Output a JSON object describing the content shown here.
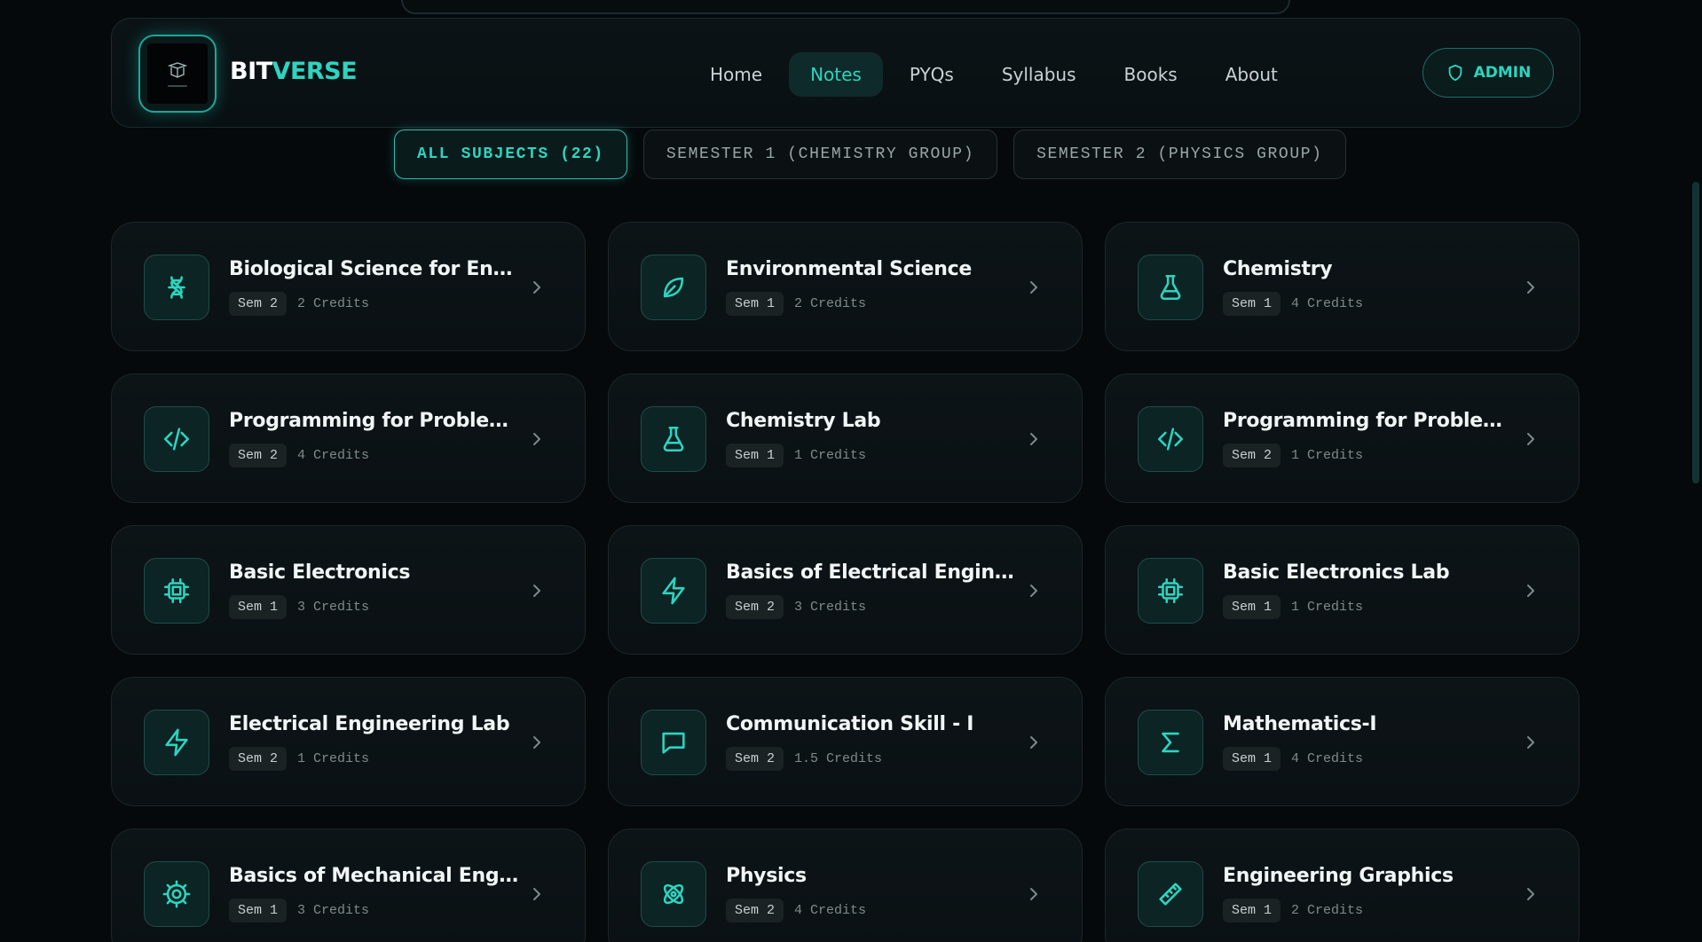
{
  "brand": {
    "part1": "BIT",
    "part2": "VERSE",
    "logo_icon": "book-logo-icon"
  },
  "nav": {
    "links": [
      {
        "label": "Home",
        "active": false
      },
      {
        "label": "Notes",
        "active": true
      },
      {
        "label": "PYQs",
        "active": false
      },
      {
        "label": "Syllabus",
        "active": false
      },
      {
        "label": "Books",
        "active": false
      },
      {
        "label": "About",
        "active": false
      }
    ],
    "admin_label": "ADMIN",
    "admin_icon": "shield-icon"
  },
  "filters": [
    {
      "label": "ALL SUBJECTS (22)",
      "active": true
    },
    {
      "label": "SEMESTER 1 (CHEMISTRY GROUP)",
      "active": false
    },
    {
      "label": "SEMESTER 2 (PHYSICS GROUP)",
      "active": false
    }
  ],
  "subjects": [
    {
      "title": "Biological Science for Engi...",
      "sem": "Sem 2",
      "credits": "2 Credits",
      "icon": "dna-icon"
    },
    {
      "title": "Environmental Science",
      "sem": "Sem 1",
      "credits": "2 Credits",
      "icon": "leaf-icon"
    },
    {
      "title": "Chemistry",
      "sem": "Sem 1",
      "credits": "4 Credits",
      "icon": "flask-icon"
    },
    {
      "title": "Programming for Problem ...",
      "sem": "Sem 2",
      "credits": "4 Credits",
      "icon": "code-icon"
    },
    {
      "title": "Chemistry Lab",
      "sem": "Sem 1",
      "credits": "1 Credits",
      "icon": "flask-icon"
    },
    {
      "title": "Programming for Problem ...",
      "sem": "Sem 2",
      "credits": "1 Credits",
      "icon": "code-icon"
    },
    {
      "title": "Basic Electronics",
      "sem": "Sem 1",
      "credits": "3 Credits",
      "icon": "chip-icon"
    },
    {
      "title": "Basics of Electrical Engine...",
      "sem": "Sem 2",
      "credits": "3 Credits",
      "icon": "lightning-icon"
    },
    {
      "title": "Basic Electronics Lab",
      "sem": "Sem 1",
      "credits": "1 Credits",
      "icon": "chip-icon"
    },
    {
      "title": "Electrical Engineering Lab",
      "sem": "Sem 2",
      "credits": "1 Credits",
      "icon": "lightning-icon"
    },
    {
      "title": "Communication Skill - I",
      "sem": "Sem 2",
      "credits": "1.5 Credits",
      "icon": "chat-bubble-icon"
    },
    {
      "title": "Mathematics-I",
      "sem": "Sem 1",
      "credits": "4 Credits",
      "icon": "sigma-icon"
    },
    {
      "title": "Basics of Mechanical Engi...",
      "sem": "Sem 1",
      "credits": "3 Credits",
      "icon": "gear-icon"
    },
    {
      "title": "Physics",
      "sem": "Sem 2",
      "credits": "4 Credits",
      "icon": "atom-icon"
    },
    {
      "title": "Engineering Graphics",
      "sem": "Sem 1",
      "credits": "2 Credits",
      "icon": "ruler-icon"
    }
  ],
  "colors": {
    "accent": "#2dd4bf",
    "background": "#05090c",
    "card": "#0d1417"
  }
}
